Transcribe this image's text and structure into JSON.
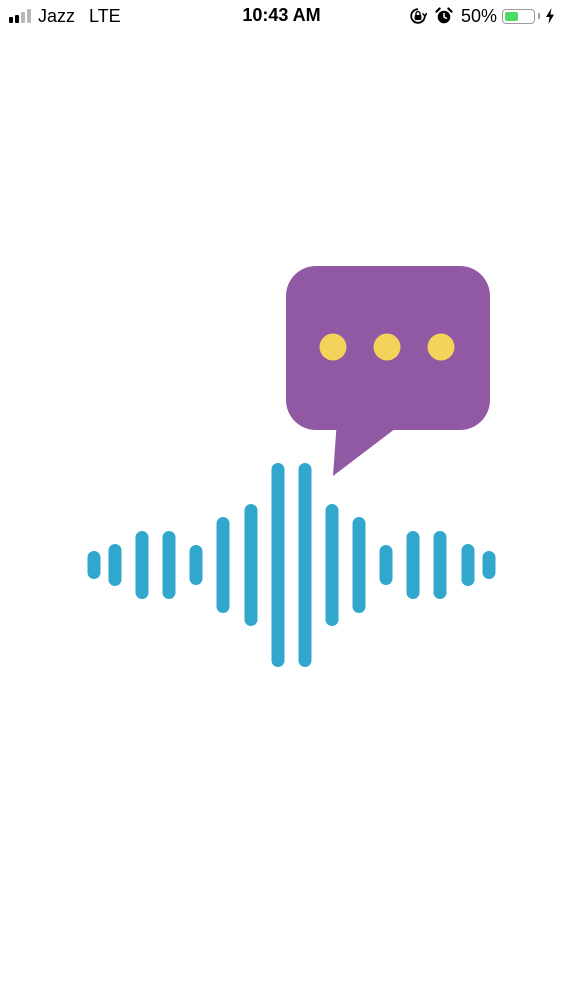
{
  "status_bar": {
    "carrier": "Jazz",
    "network": "LTE",
    "time": "10:43 AM",
    "battery_percent": "50%",
    "battery_level": 0.5,
    "signal_bars_filled": 2,
    "signal_bars_total": 4,
    "icons": [
      "orientation-lock-icon",
      "alarm-icon",
      "battery-icon",
      "charging-bolt-icon"
    ]
  },
  "logo": {
    "bubble_color": "#9158a4",
    "dot_color": "#f3d35a",
    "wave_color": "#31a7cd",
    "icons": [
      "speech-bubble-icon",
      "sound-wave-icon"
    ]
  }
}
